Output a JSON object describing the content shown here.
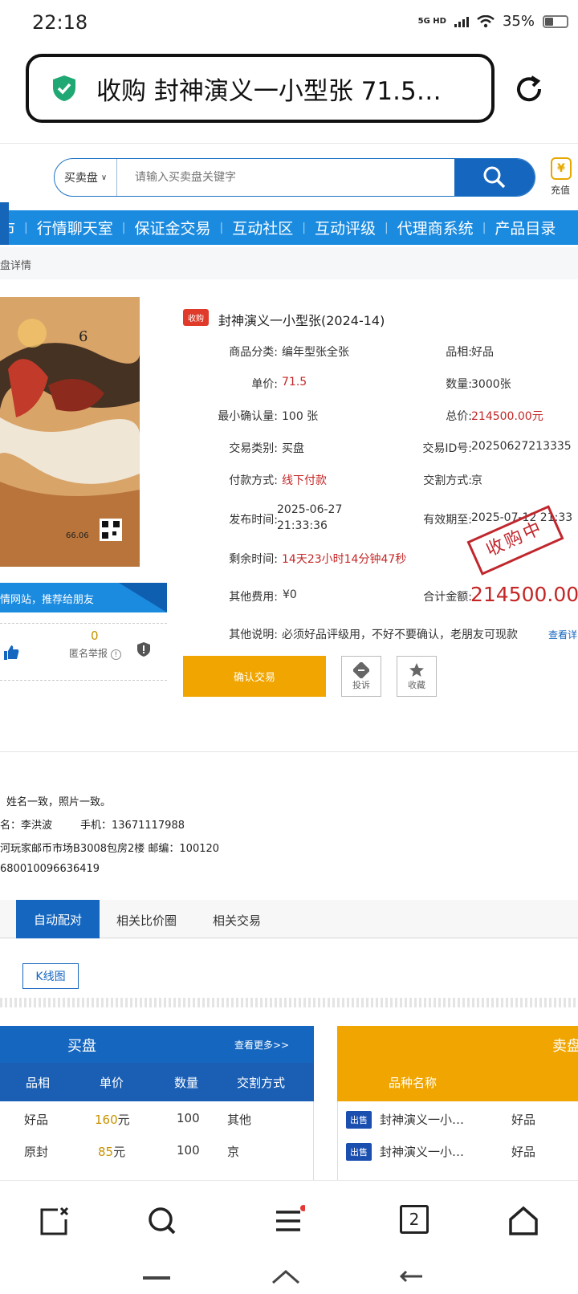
{
  "status_bar": {
    "time": "22:18",
    "network": "5G HD",
    "battery": "35%"
  },
  "browser": {
    "url_text": "收购 封神演义一小型张 71.5…",
    "tab_count": "2"
  },
  "search": {
    "type": "买卖盘",
    "placeholder": "请输入买卖盘关键字"
  },
  "recharge": {
    "label": "充值"
  },
  "nav": {
    "items": [
      "行情聊天室",
      "保证金交易",
      "互动社区",
      "互动评级",
      "代理商系统",
      "产品目录"
    ],
    "left_fragment": "市"
  },
  "breadcrumb": "盘详情",
  "product": {
    "image_number": "6",
    "image_caption": "66.06",
    "tag": "收购",
    "title": "封神演义一小型张(2024-14)",
    "fields": [
      {
        "label": "商品分类:",
        "value": "编年型张全张",
        "red": false
      },
      {
        "label": "品相:",
        "value": "好品",
        "red": false
      },
      {
        "label": "单价:",
        "value": "71.5",
        "red": true
      },
      {
        "label": "数量:",
        "value": "3000张",
        "red": false
      },
      {
        "label": "最小确认量:",
        "value": "100 张",
        "red": false
      },
      {
        "label": "总价:",
        "value": "214500.00元",
        "red": true
      },
      {
        "label": "交易类别:",
        "value": "买盘",
        "red": false
      },
      {
        "label": "交易ID号:",
        "value": "20250627213335",
        "red": false
      },
      {
        "label": "付款方式:",
        "value": "线下付款",
        "red": true
      },
      {
        "label": "交割方式:",
        "value": "京",
        "red": false
      },
      {
        "label": "发布时间:",
        "value": "2025-06-27",
        "red": false
      },
      {
        "label": "有效期至:",
        "value": "2025-07-12 21:33",
        "red": false
      }
    ],
    "publish_time_2": "21:33:36",
    "remaining_label": "剩余时间:",
    "remaining_value": "14天23小时14分钟47秒",
    "other_fee_label": "其他费用:",
    "other_fee_value": "¥0",
    "total_label": "合计金额:",
    "total_value": "214500.00",
    "remark_label": "其他说明:",
    "remark_value": "必须好品评级用，不好不要确认，老朋友可现款",
    "remark_link": "查看详",
    "stamp": "收购中",
    "confirm_btn": "确认交易",
    "complain_btn": "投诉",
    "favorite_btn": "收藏"
  },
  "share": {
    "text": "情网站，推荐给朋友",
    "report_count": "0",
    "report_label": "匿名举报"
  },
  "seller": {
    "line1": "姓名一致，照片一致。",
    "name_label": "名：",
    "name": "李洪波",
    "phone_label": "手机：",
    "phone": "13671117988",
    "address": "河玩家邮币市场B3008包房2楼 邮编：100120",
    "account": "680010096636419"
  },
  "tabs": {
    "active": "自动配对",
    "items": [
      "相关比价圈",
      "相关交易"
    ],
    "kline": "K线图"
  },
  "buy_panel": {
    "title": "买盘",
    "more": "查看更多>>",
    "columns": [
      "品相",
      "单价",
      "数量",
      "交割方式"
    ],
    "rows": [
      {
        "condition": "好品",
        "price": "160",
        "unit": "元",
        "qty": "100",
        "delivery": "其他"
      },
      {
        "condition": "原封",
        "price": "85",
        "unit": "元",
        "qty": "100",
        "delivery": "京"
      }
    ]
  },
  "sell_panel": {
    "title": "卖盘",
    "columns": [
      "品种名称"
    ],
    "rows": [
      {
        "badge": "出售",
        "name": "封神演义一小…",
        "condition": "好品"
      },
      {
        "badge": "出售",
        "name": "封神演义一小…",
        "condition": "好品"
      }
    ]
  },
  "colors": {
    "primary_blue": "#1566bf",
    "nav_blue": "#1b8be0",
    "accent_orange": "#f0a500",
    "price_red": "#c42626"
  }
}
